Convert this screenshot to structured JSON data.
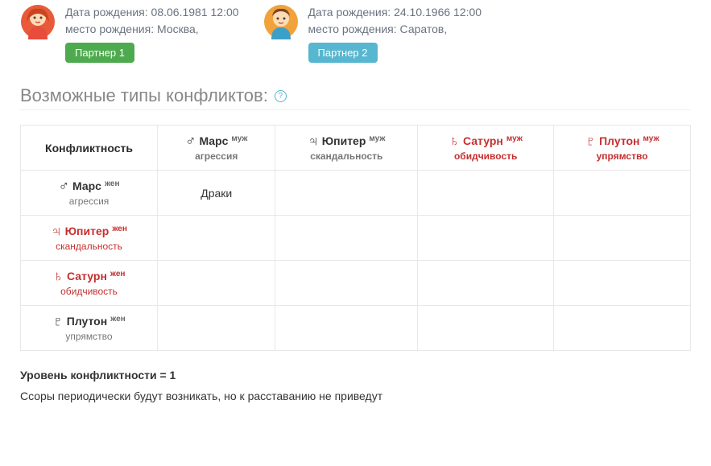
{
  "partners": [
    {
      "birth_label": "Дата рождения:",
      "birth_value": "08.06.1981 12:00",
      "place_label": "место рождения:",
      "place_value": "Москва,",
      "badge": "Партнер 1"
    },
    {
      "birth_label": "Дата рождения:",
      "birth_value": "24.10.1966 12:00",
      "place_label": "место рождения:",
      "place_value": "Саратов,",
      "badge": "Партнер 2"
    }
  ],
  "section_title": "Возможные типы конфликтов:",
  "table": {
    "corner": "Конфликтность",
    "gender_col": "муж",
    "gender_row": "жен",
    "cols": [
      {
        "glyph": "♂",
        "name": "Марс",
        "trait": "агрессия",
        "red": false
      },
      {
        "glyph": "♃",
        "name": "Юпитер",
        "trait": "скандальность",
        "red": false
      },
      {
        "glyph": "♄",
        "name": "Сатурн",
        "trait": "обидчивость",
        "red": true
      },
      {
        "glyph": "♇",
        "name": "Плутон",
        "trait": "упрямство",
        "red": true
      }
    ],
    "rows": [
      {
        "glyph": "♂",
        "name": "Марс",
        "trait": "агрессия",
        "red": false,
        "cells": [
          "Драки",
          "",
          "",
          ""
        ]
      },
      {
        "glyph": "♃",
        "name": "Юпитер",
        "trait": "скандальность",
        "red": true,
        "cells": [
          "",
          "",
          "",
          ""
        ]
      },
      {
        "glyph": "♄",
        "name": "Сатурн",
        "trait": "обидчивость",
        "red": true,
        "cells": [
          "",
          "",
          "",
          ""
        ]
      },
      {
        "glyph": "♇",
        "name": "Плутон",
        "trait": "упрямство",
        "red": false,
        "cells": [
          "",
          "",
          "",
          ""
        ]
      }
    ]
  },
  "level_label": "Уровень конфликтности = 1",
  "note": "Ссоры периодически будут возникать, но к расставанию не приведут",
  "help_glyph": "?"
}
